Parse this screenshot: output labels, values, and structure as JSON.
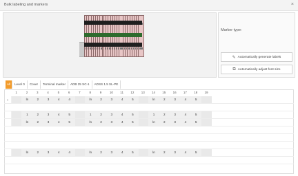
{
  "window": {
    "title": "Bulk labeling and markers",
    "close_icon": "×"
  },
  "side": {
    "marker_type_label": "Marker type:",
    "btn_generate": "Automatically generate labels",
    "btn_adjust": "Automatically adjust font size"
  },
  "tabs": [
    {
      "label": "All"
    },
    {
      "label": "Level 0"
    },
    {
      "label": "Cover"
    },
    {
      "label": "Terminal marker"
    },
    {
      "label": "ADB 25 SC-1"
    },
    {
      "label": "ADSS 1.5 SL-PE"
    }
  ],
  "grid": {
    "columns": [
      "1",
      "2",
      "3",
      "4",
      "5",
      "6",
      "7",
      "8",
      "9",
      "10",
      "11",
      "12",
      "13",
      "14",
      "15",
      "16",
      "17",
      "18",
      "19"
    ],
    "rows": [
      {
        "lead": "•",
        "cells": [
          "",
          "ln",
          "2",
          "3",
          "4",
          "4",
          "",
          "ln",
          "2",
          "3",
          "4",
          "5",
          "",
          "ln",
          "2",
          "3",
          "4",
          "5",
          ""
        ]
      },
      {
        "lead": "",
        "cells": [
          "",
          "1",
          "2",
          "3",
          "4",
          "5",
          "",
          "1",
          "2",
          "3",
          "4",
          "5",
          "",
          "1",
          "2",
          "3",
          "4",
          "5",
          ""
        ]
      },
      {
        "lead": "",
        "cells": [
          "",
          "ln",
          "2",
          "3",
          "4",
          "5",
          "",
          "ln",
          "2",
          "3",
          "4",
          "5",
          "",
          "ln",
          "2",
          "3",
          "4",
          "5",
          ""
        ]
      },
      {
        "lead": "",
        "cells": [
          "",
          "ln",
          "2",
          "3",
          "4",
          "4",
          "",
          "ln",
          "2",
          "3",
          "4",
          "5",
          "",
          "ln",
          "2",
          "3",
          "4",
          "5",
          ""
        ]
      }
    ]
  }
}
